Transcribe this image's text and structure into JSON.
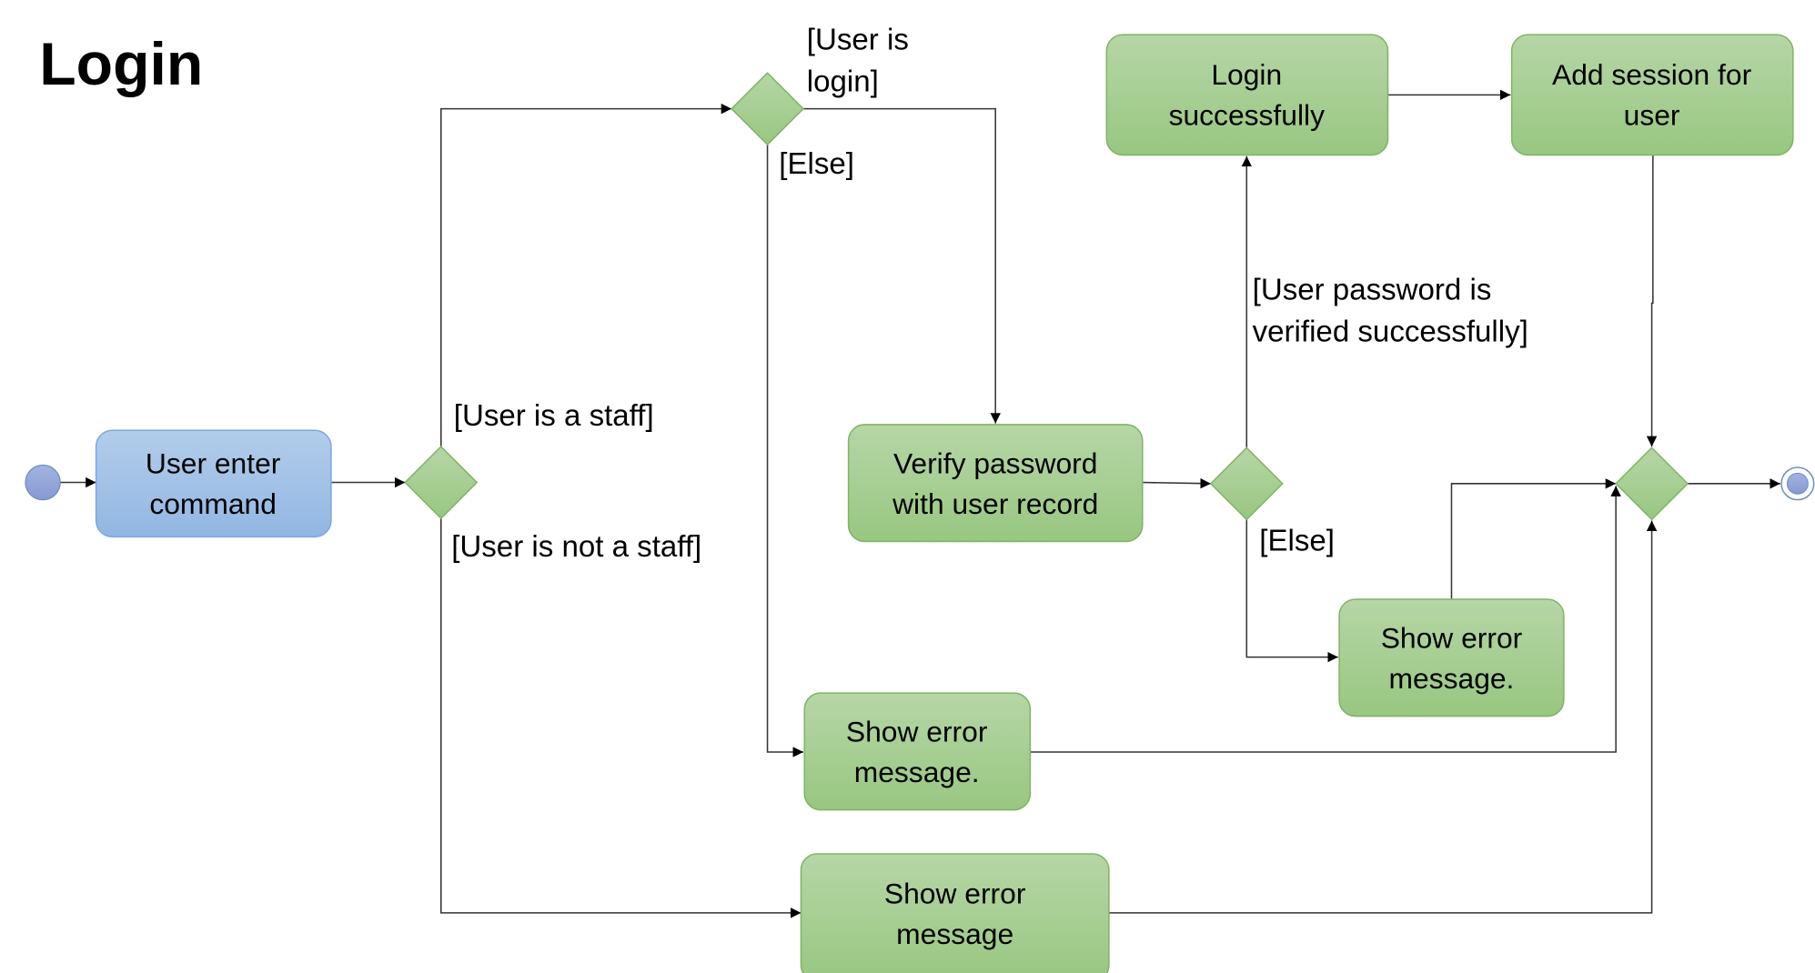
{
  "title": "Login",
  "colors": {
    "action_fill_green": "#a9cf96",
    "action_stroke_green": "#82b366",
    "action_fill_blue": "#a6c3e8",
    "action_stroke_blue": "#7ea6e0",
    "start_node": "#8e9fd6"
  },
  "nodes": {
    "user_enter_command": [
      "User enter",
      "command"
    ],
    "verify_password": [
      "Verify password",
      "with user record"
    ],
    "login_successfully": [
      "Login",
      "successfully"
    ],
    "add_session": [
      "Add session for",
      "user"
    ],
    "show_error_password": [
      "Show error",
      "message."
    ],
    "show_error_logged_in": [
      "Show error",
      "message."
    ],
    "show_error_not_staff": [
      "Show error",
      "message"
    ]
  },
  "guards": {
    "is_staff": "[User is a staff]",
    "not_staff": "[User is not a staff]",
    "is_login": [
      "[User is",
      "login]"
    ],
    "else_login": "[Else]",
    "password_ok": [
      "[User password is",
      "verified successfully]"
    ],
    "else_password": "[Else]"
  }
}
